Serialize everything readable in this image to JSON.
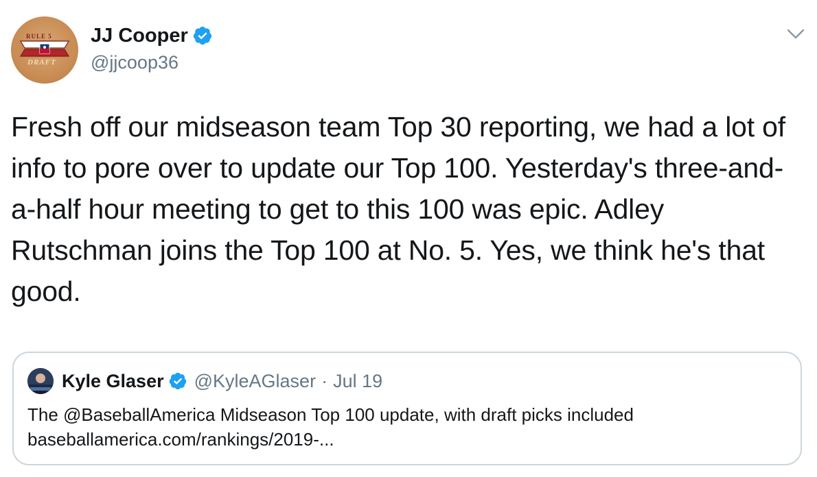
{
  "author": {
    "display_name": "JJ Cooper",
    "handle": "@jjcoop36",
    "avatar_logo_icon": "rule-5-draft-logo",
    "avatar_logo_text_top": "RULE 5",
    "avatar_logo_text_bottom": "DRAFT"
  },
  "tweet": {
    "text": "Fresh off our midseason team Top 30 reporting, we had a lot of info to pore over to update our Top 100. Yesterday's three-and-a-half hour meeting to get to this 100 was epic. Adley Rutschman joins the Top 100 at No. 5. Yes, we think he's that good."
  },
  "quoted_tweet": {
    "display_name": "Kyle Glaser",
    "handle": "@KyleAGlaser",
    "separator": "·",
    "date": "Jul 19",
    "text_line1": "The @BaseballAmerica Midseason Top 100 update, with draft picks included",
    "text_line2": "baseballamerica.com/rankings/2019-..."
  },
  "icons": {
    "verified": "verified-badge-icon",
    "caret": "chevron-down-icon"
  },
  "colors": {
    "verified_blue": "#1da1f2",
    "secondary_text": "#657786",
    "border": "#ccd6dd"
  }
}
